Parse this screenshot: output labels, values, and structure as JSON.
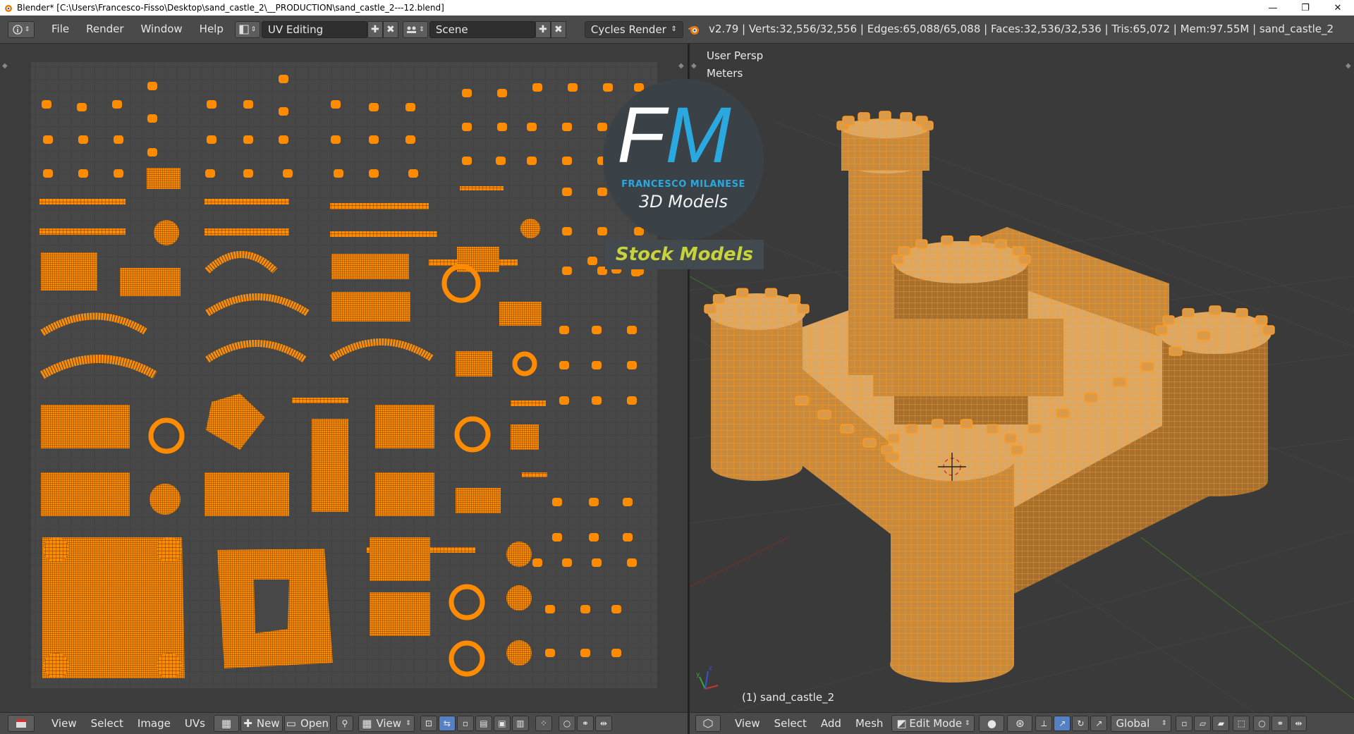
{
  "window": {
    "title": "Blender* [C:\\Users\\Francesco-Fisso\\Desktop\\sand_castle_2\\__PRODUCTION\\sand_castle_2---12.blend]",
    "controls": [
      "—",
      "❐",
      "✕"
    ]
  },
  "infobar": {
    "menus": [
      "File",
      "Render",
      "Window",
      "Help"
    ],
    "screen_layout": "UV Editing",
    "scene": "Scene",
    "render_engine": "Cycles Render",
    "stats": "v2.79 | Verts:32,556/32,556 | Edges:65,088/65,088 | Faces:32,536/32,536 | Tris:65,072 | Mem:97.55M | sand_castle_2"
  },
  "uv_editor": {
    "footer": {
      "menus": [
        "View",
        "Select",
        "Image",
        "UVs"
      ],
      "new_label": "New",
      "open_label": "Open",
      "view_label": "View"
    }
  },
  "viewport": {
    "view_name": "User Persp",
    "units": "Meters",
    "object_label": "(1) sand_castle_2",
    "footer": {
      "menus": [
        "View",
        "Select",
        "Add",
        "Mesh"
      ],
      "mode": "Edit Mode",
      "orientation": "Global"
    }
  },
  "logo": {
    "initials_f": "F",
    "initials_m": "M",
    "name": "FRANCESCO MILANESE",
    "tagline": "3D Models",
    "stock": "Stock Models",
    "colors": {
      "f": "#ffffff",
      "m": "#2aa9e0",
      "stock": "#c8d23a"
    }
  },
  "colors": {
    "accent_orange": "#ff8c00",
    "panel": "#4a4a4a",
    "field": "#2f2f2f",
    "active_blue": "#5680c2"
  }
}
